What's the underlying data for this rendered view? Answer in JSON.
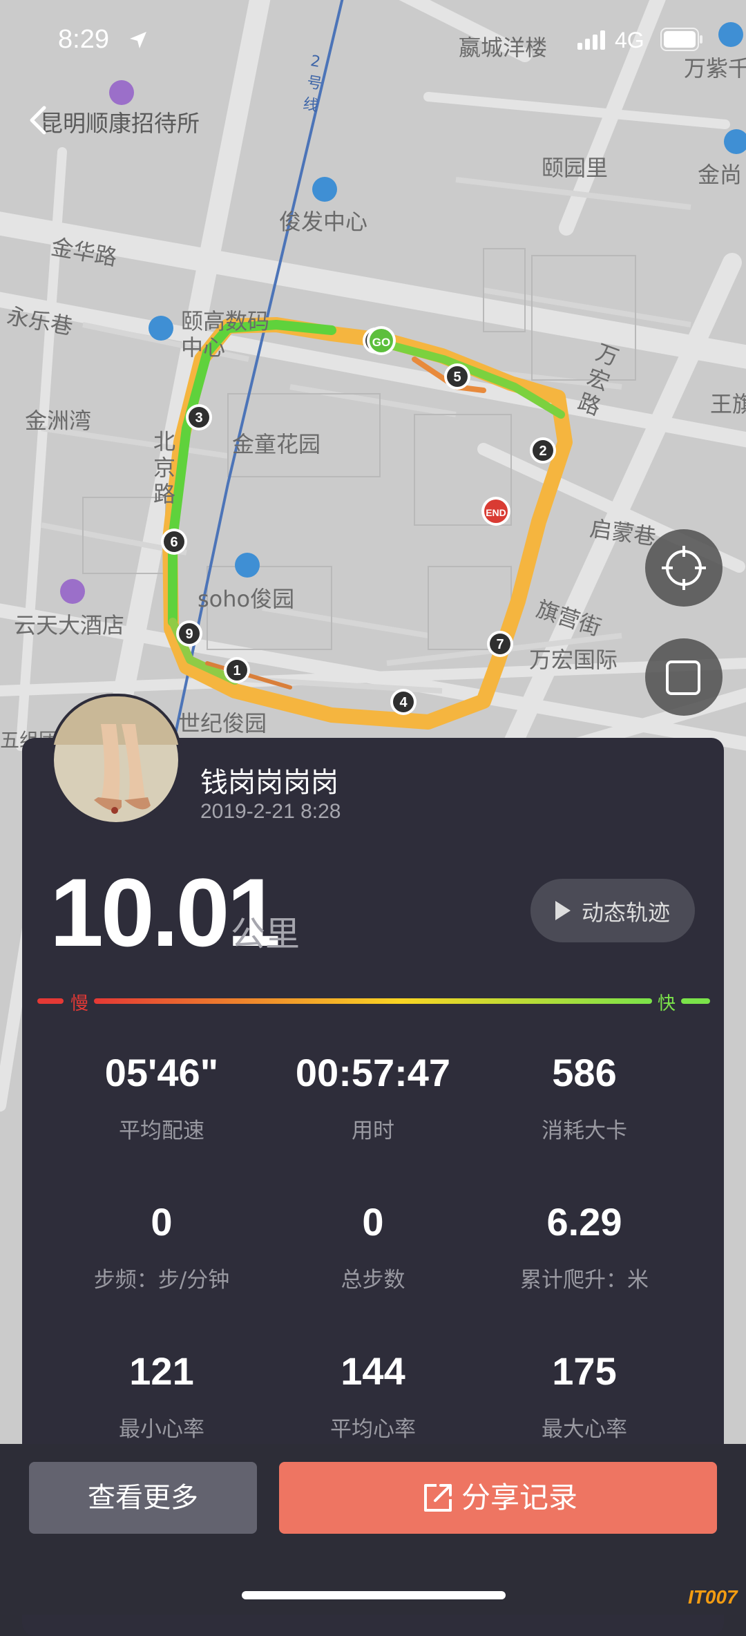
{
  "status": {
    "time": "8:29",
    "network": "4G"
  },
  "map": {
    "labels": [
      "昆明顺康招待所",
      "俊发中心",
      "金华路",
      "永乐巷",
      "颐高数码",
      "中心",
      "金洲湾",
      "金童花园",
      "北京路",
      "soho俊园",
      "云天大酒店",
      "世纪俊园",
      "颐园里",
      "万宏路",
      "王旗",
      "启蒙巷",
      "旗营街",
      "万宏国际",
      "嬴城洋楼",
      "万紫千",
      "金尚",
      "2号线",
      "五组团"
    ],
    "route_markers": [
      "GO",
      "END",
      "1",
      "2",
      "3",
      "4",
      "5",
      "6",
      "7",
      "9"
    ]
  },
  "profile": {
    "name": "钱岗岗岗岗",
    "datetime": "2019-2-21 8:28"
  },
  "summary": {
    "distance": "10.01",
    "unit": "公里",
    "replay_label": "动态轨迹"
  },
  "speed_legend": {
    "slow": "慢",
    "fast": "快",
    "colors": [
      "#e53935",
      "#f9d423",
      "#7be34a"
    ]
  },
  "stats": [
    {
      "value": "05'46\"",
      "label": "平均配速"
    },
    {
      "value": "00:57:47",
      "label": "用时"
    },
    {
      "value": "586",
      "label": "消耗大卡"
    },
    {
      "value": "0",
      "label": "步频：步/分钟"
    },
    {
      "value": "0",
      "label": "总步数"
    },
    {
      "value": "6.29",
      "label": "累计爬升：米"
    },
    {
      "value": "121",
      "label": "最小心率"
    },
    {
      "value": "144",
      "label": "平均心率"
    },
    {
      "value": "175",
      "label": "最大心率"
    }
  ],
  "actions": {
    "more": "查看更多",
    "share": "分享记录"
  },
  "watermark": "IT007"
}
